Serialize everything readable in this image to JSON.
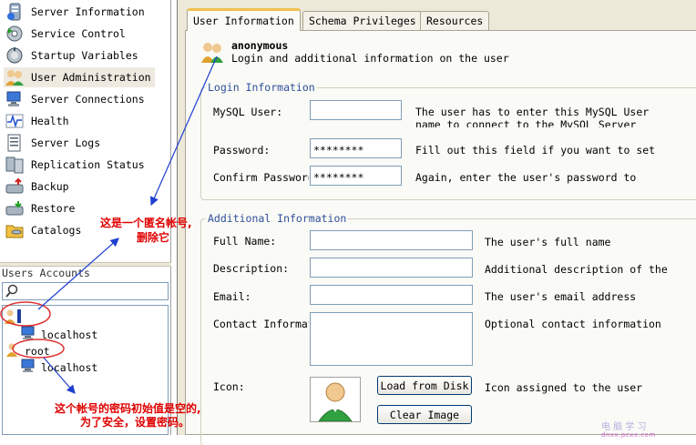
{
  "nav": {
    "items": [
      {
        "label": "Server Information",
        "icon": "server-info-icon"
      },
      {
        "label": "Service Control",
        "icon": "service-control-icon"
      },
      {
        "label": "Startup Variables",
        "icon": "startup-variables-icon"
      },
      {
        "label": "User Administration",
        "icon": "user-admin-icon"
      },
      {
        "label": "Server Connections",
        "icon": "server-connections-icon"
      },
      {
        "label": "Health",
        "icon": "health-icon"
      },
      {
        "label": "Server Logs",
        "icon": "server-logs-icon"
      },
      {
        "label": "Replication Status",
        "icon": "replication-icon"
      },
      {
        "label": "Backup",
        "icon": "backup-icon"
      },
      {
        "label": "Restore",
        "icon": "restore-icon"
      },
      {
        "label": "Catalogs",
        "icon": "catalogs-icon"
      }
    ]
  },
  "accounts": {
    "title": "Users Accounts",
    "items": [
      {
        "label": "",
        "icon": "anonymous-user-icon"
      },
      {
        "label": "localhost",
        "icon": "host-icon"
      },
      {
        "label": "root",
        "icon": "user-icon"
      },
      {
        "label": "localhost",
        "icon": "host-icon"
      }
    ]
  },
  "tabs": {
    "user_information": "User Information",
    "schema_privileges": "Schema Privileges",
    "resources": "Resources"
  },
  "user": {
    "name": "anonymous",
    "description": "Login and additional information on the user"
  },
  "login": {
    "legend": "Login Information",
    "mysql_user_label": "MySQL User:",
    "mysql_user_value": "",
    "mysql_user_hint_1": "The user has to enter this MySQL User",
    "mysql_user_hint_2": "name to connect to the MySQL Server",
    "password_label": "Password:",
    "password_value": "********",
    "password_hint": "Fill out this field if you want to set",
    "confirm_label": "Confirm Password:",
    "confirm_value": "********",
    "confirm_hint": "Again, enter the user's password to"
  },
  "additional": {
    "legend": "Additional Information",
    "full_name_label": "Full Name:",
    "full_name_hint": "The user's full name",
    "description_label": "Description:",
    "description_hint": "Additional description of the",
    "email_label": "Email:",
    "email_hint": "The user's email address",
    "contact_label": "Contact Information:",
    "contact_hint": "Optional contact information",
    "icon_label": "Icon:",
    "load_button": "Load from Disk",
    "clear_button": "Clear Image",
    "icon_hint": "Icon assigned to the user"
  },
  "annotations": {
    "anon_line1": "这是一个匿名帐号,",
    "anon_line2": "删除它",
    "root_line1": "这个帐号的密码初始值是空的,",
    "root_line2": "为了安全，设置密码。"
  },
  "watermark": {
    "line1": "电 脑 学 习",
    "line2": "dnxx.pcxx.com"
  },
  "colors": {
    "annotation": "#e00000",
    "arrow": "#1f3fd0",
    "legend": "#2e4f9a",
    "tab_highlight": "#f0c050"
  }
}
